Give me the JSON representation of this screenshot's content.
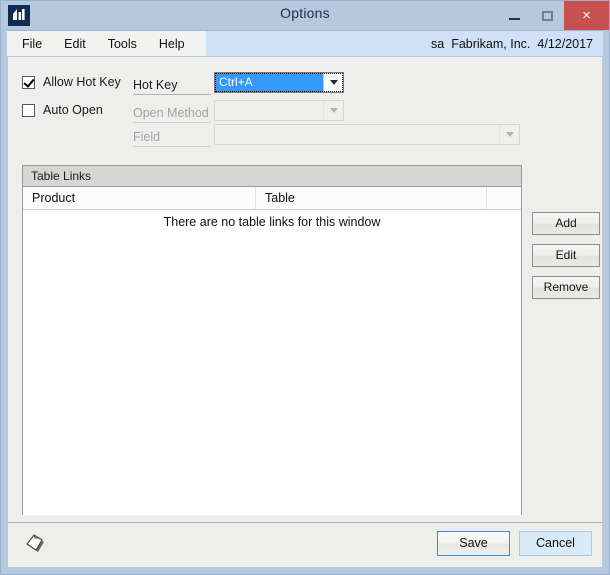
{
  "window": {
    "title": "Options",
    "app_icon": "chart-app-icon",
    "controls": {
      "minimize": "minimize-icon",
      "maximize": "maximize-icon",
      "close": "×"
    }
  },
  "menubar": {
    "items": [
      {
        "label": "File"
      },
      {
        "label": "Edit"
      },
      {
        "label": "Tools"
      },
      {
        "label": "Help"
      }
    ],
    "status": {
      "user": "sa",
      "company": "Fabrikam, Inc.",
      "date": "4/12/2017"
    }
  },
  "options": {
    "allow_hot_key": {
      "label": "Allow Hot Key",
      "checked": true
    },
    "auto_open": {
      "label": "Auto Open",
      "checked": false
    },
    "hot_key": {
      "label": "Hot Key",
      "value": "Ctrl+A",
      "selected": true,
      "enabled": true
    },
    "open_method": {
      "label": "Open Method",
      "value": "",
      "enabled": false
    },
    "field": {
      "label": "Field",
      "value": "",
      "enabled": false
    }
  },
  "table_links": {
    "caption": "Table Links",
    "columns": [
      "Product",
      "Table",
      ""
    ],
    "rows": [],
    "empty_message": "There are no table links for this window"
  },
  "side_buttons": [
    {
      "label": "Add"
    },
    {
      "label": "Edit"
    },
    {
      "label": "Remove"
    }
  ],
  "footer": {
    "note_icon": "note-icon",
    "save_label": "Save",
    "cancel_label": "Cancel"
  },
  "colors": {
    "titlebar": "#b6c8de",
    "close_button": "#c75050",
    "menubar_status": "#cfe0f7",
    "selection_blue": "#3399ff",
    "client_background": "#eeeeec",
    "primary_button_border": "#3c8bd0"
  }
}
